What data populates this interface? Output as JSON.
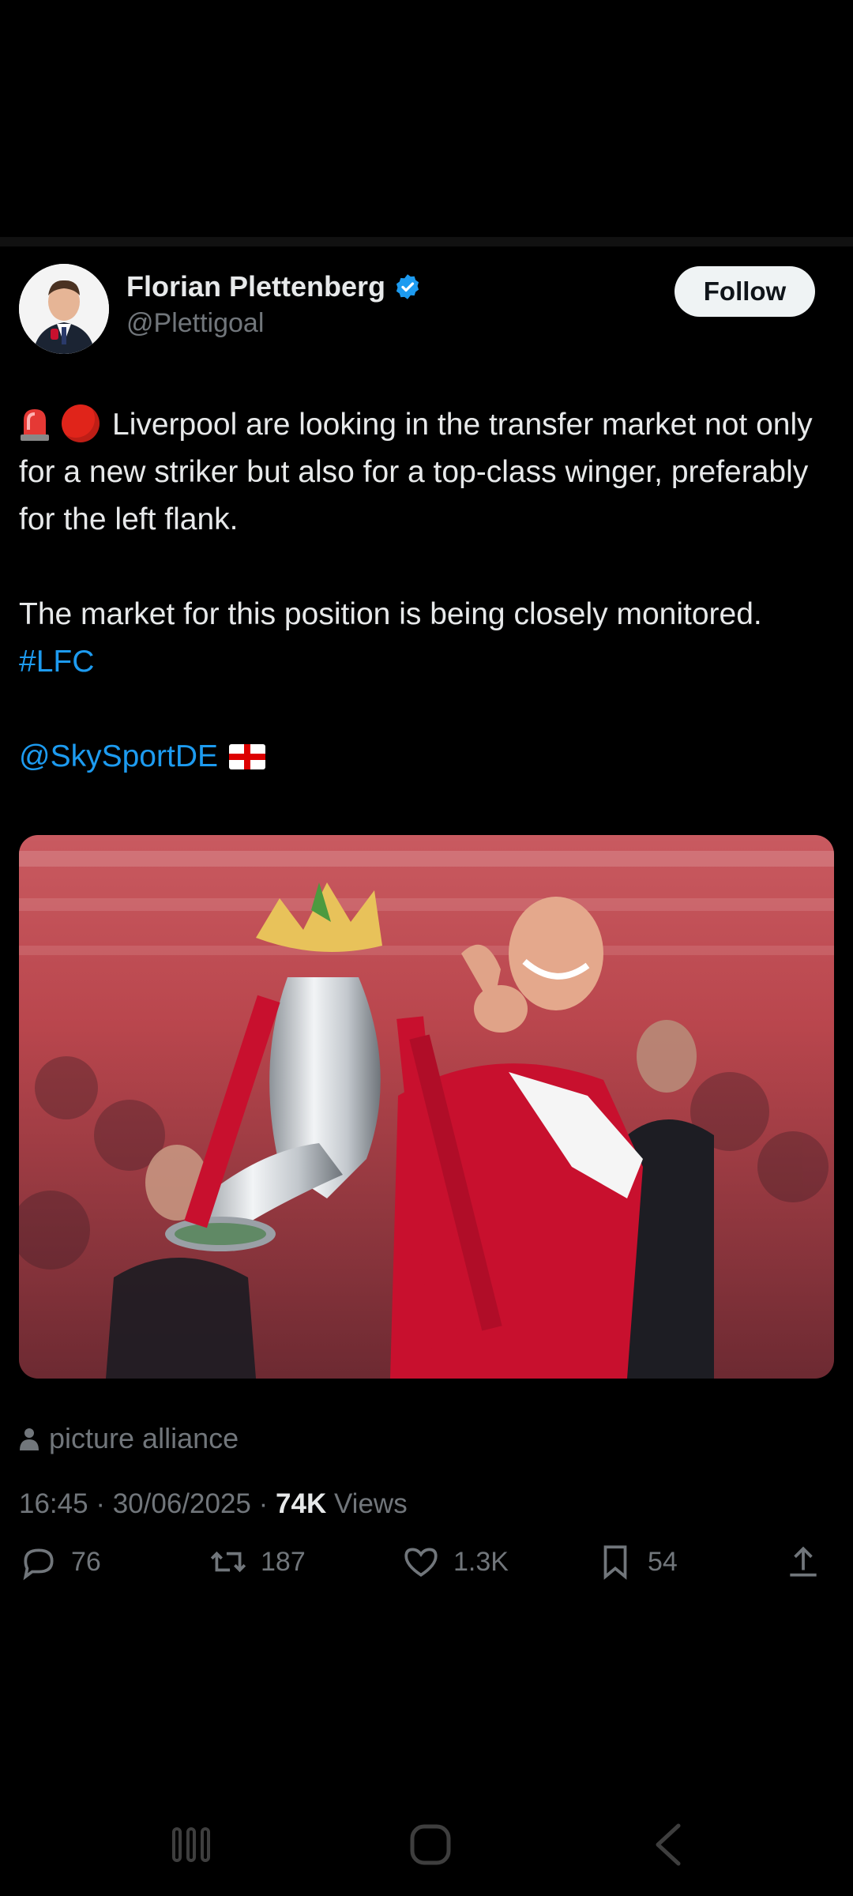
{
  "author": {
    "name": "Florian Plettenberg",
    "handle": "@Plettigoal"
  },
  "follow_label": "Follow",
  "tweet": {
    "line1_text": "Liverpool are looking in the transfer market not only for a new striker but also for a top-class winger, preferably for the left flank.",
    "line2_text": "The market for this position is being closely monitored.",
    "hashtag": "#LFC",
    "mention": "@SkySportDE"
  },
  "media_credit": "picture alliance",
  "meta": {
    "time": "16:45",
    "date": "30/06/2025",
    "views": "74K",
    "views_label": "Views",
    "sep": "·"
  },
  "actions": {
    "replies": "76",
    "reposts": "187",
    "likes": "1.3K",
    "bookmarks": "54"
  },
  "colors": {
    "accent": "#1d9bf0",
    "text": "#e7e9ea",
    "muted": "#71767b",
    "background": "#000000"
  },
  "icons": [
    "verified-badge-icon",
    "person-icon",
    "reply-icon",
    "repost-icon",
    "like-icon",
    "bookmark-icon",
    "share-icon",
    "recent-apps-icon",
    "home-icon",
    "back-icon"
  ]
}
